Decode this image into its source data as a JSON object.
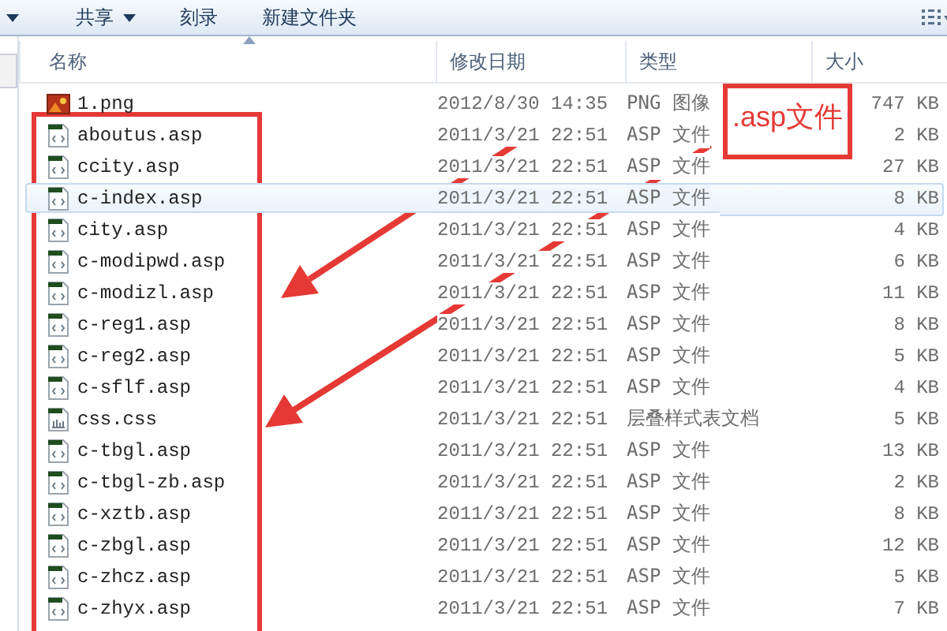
{
  "toolbar": {
    "items": [
      {
        "label": "共享",
        "dropdown": true
      },
      {
        "label": "刻录",
        "dropdown": false
      },
      {
        "label": "新建文件夹",
        "dropdown": false
      }
    ]
  },
  "columns": [
    {
      "label": "名称",
      "sorted": true
    },
    {
      "label": "修改日期",
      "sorted": false
    },
    {
      "label": "类型",
      "sorted": false
    },
    {
      "label": "大小",
      "sorted": false
    }
  ],
  "files": [
    {
      "name": "1.png",
      "modified": "2012/8/30 14:35",
      "type": "PNG 图像",
      "size": "747 KB",
      "kind": "image",
      "selected": false
    },
    {
      "name": "aboutus.asp",
      "modified": "2011/3/21 22:51",
      "type": "ASP 文件",
      "size": "2 KB",
      "kind": "asp",
      "selected": false
    },
    {
      "name": "ccity.asp",
      "modified": "2011/3/21 22:51",
      "type": "ASP 文件",
      "size": "27 KB",
      "kind": "asp",
      "selected": false
    },
    {
      "name": "c-index.asp",
      "modified": "2011/3/21 22:51",
      "type": "ASP 文件",
      "size": "8 KB",
      "kind": "asp",
      "selected": true
    },
    {
      "name": "city.asp",
      "modified": "2011/3/21 22:51",
      "type": "ASP 文件",
      "size": "4 KB",
      "kind": "asp",
      "selected": false
    },
    {
      "name": "c-modipwd.asp",
      "modified": "2011/3/21 22:51",
      "type": "ASP 文件",
      "size": "6 KB",
      "kind": "asp",
      "selected": false
    },
    {
      "name": "c-modizl.asp",
      "modified": "2011/3/21 22:51",
      "type": "ASP 文件",
      "size": "11 KB",
      "kind": "asp",
      "selected": false
    },
    {
      "name": "c-reg1.asp",
      "modified": "2011/3/21 22:51",
      "type": "ASP 文件",
      "size": "8 KB",
      "kind": "asp",
      "selected": false
    },
    {
      "name": "c-reg2.asp",
      "modified": "2011/3/21 22:51",
      "type": "ASP 文件",
      "size": "5 KB",
      "kind": "asp",
      "selected": false
    },
    {
      "name": "c-sflf.asp",
      "modified": "2011/3/21 22:51",
      "type": "ASP 文件",
      "size": "4 KB",
      "kind": "asp",
      "selected": false
    },
    {
      "name": "css.css",
      "modified": "2011/3/21 22:51",
      "type": "层叠样式表文档",
      "size": "5 KB",
      "kind": "css",
      "selected": false
    },
    {
      "name": "c-tbgl.asp",
      "modified": "2011/3/21 22:51",
      "type": "ASP 文件",
      "size": "13 KB",
      "kind": "asp",
      "selected": false
    },
    {
      "name": "c-tbgl-zb.asp",
      "modified": "2011/3/21 22:51",
      "type": "ASP 文件",
      "size": "2 KB",
      "kind": "asp",
      "selected": false
    },
    {
      "name": "c-xztb.asp",
      "modified": "2011/3/21 22:51",
      "type": "ASP 文件",
      "size": "8 KB",
      "kind": "asp",
      "selected": false
    },
    {
      "name": "c-zbgl.asp",
      "modified": "2011/3/21 22:51",
      "type": "ASP 文件",
      "size": "12 KB",
      "kind": "asp",
      "selected": false
    },
    {
      "name": "c-zhcz.asp",
      "modified": "2011/3/21 22:51",
      "type": "ASP 文件",
      "size": "5 KB",
      "kind": "asp",
      "selected": false
    },
    {
      "name": "c-zhyx.asp",
      "modified": "2011/3/21 22:51",
      "type": "ASP 文件",
      "size": "7 KB",
      "kind": "asp",
      "selected": false
    }
  ],
  "annotation": {
    "label": ".asp文件"
  }
}
